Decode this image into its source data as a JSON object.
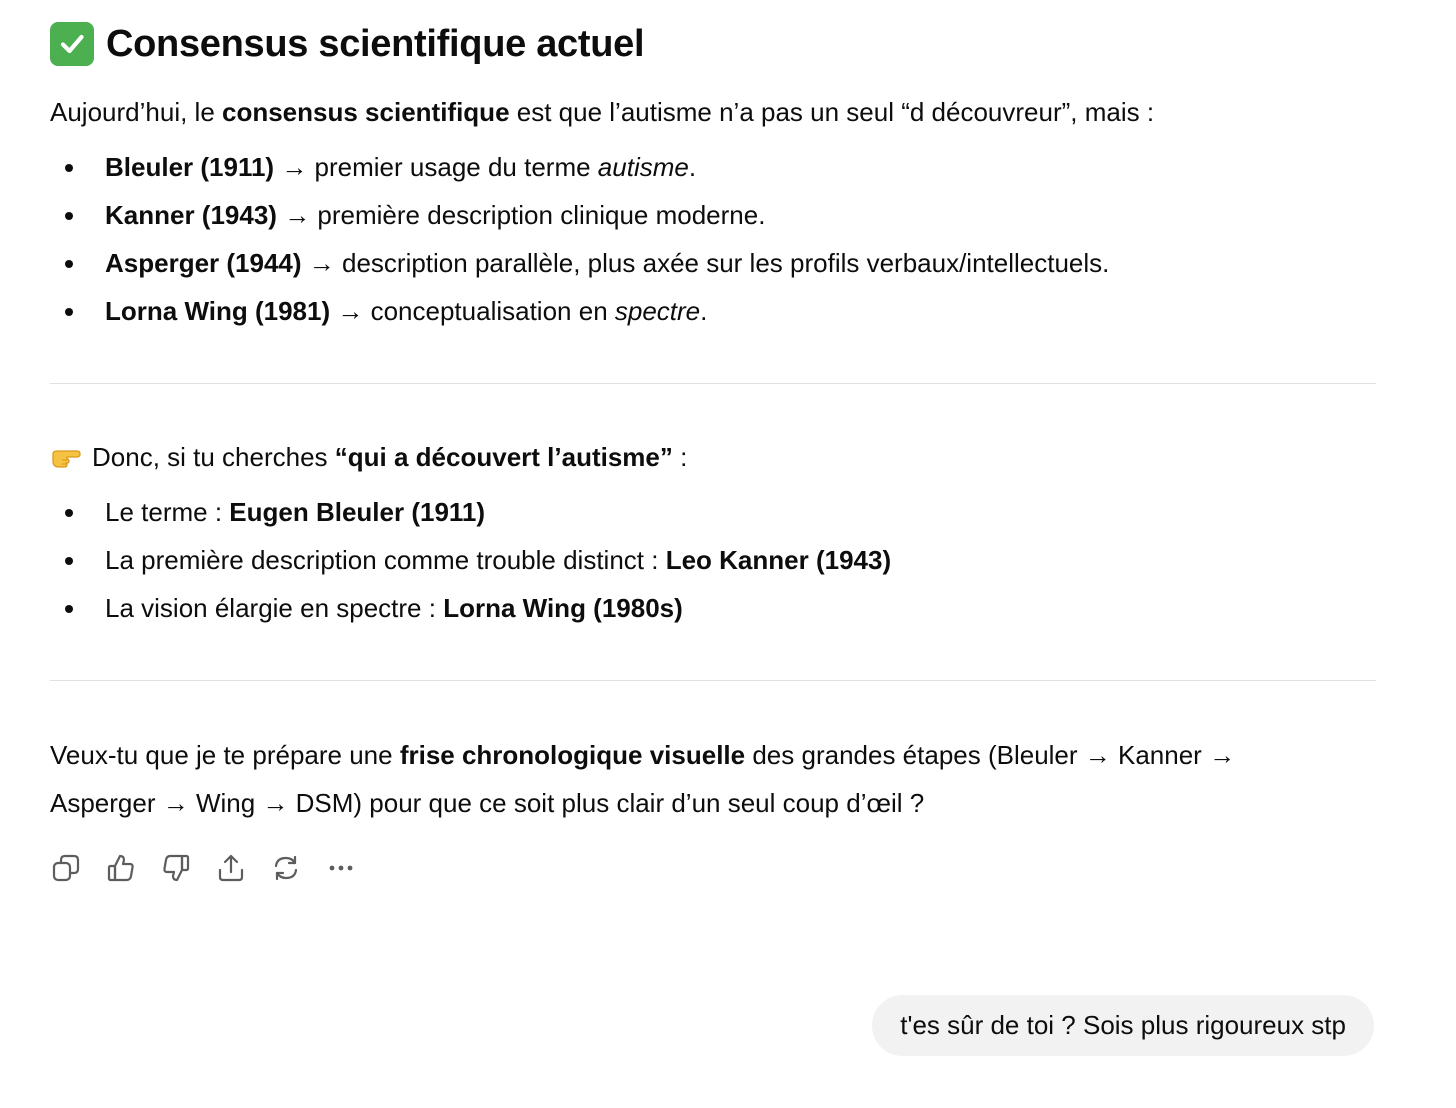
{
  "heading": {
    "icon": "check-mark-button-icon",
    "title": "Consensus scientifique actuel"
  },
  "intro": {
    "prefix": "Aujourd’hui, le ",
    "bold": "consensus scientifique",
    "suffix": " est que l’autisme n’a pas un seul “d découvreur”, mais :"
  },
  "consensus_list": [
    {
      "bold": "Bleuler (1911)",
      "text": " → premier usage du terme ",
      "italic": "autisme",
      "end": "."
    },
    {
      "bold": "Kanner (1943)",
      "text": " → première description clinique moderne."
    },
    {
      "bold": "Asperger (1944)",
      "text": " → description parallèle, plus axée sur les profils verbaux/intellectuels."
    },
    {
      "bold": "Lorna Wing (1981)",
      "text": " → conceptualisation en ",
      "italic": "spectre",
      "end": "."
    }
  ],
  "summary": {
    "icon": "backhand-pointing-right-icon",
    "prefix": "Donc, si tu cherches ",
    "bold": "“qui a découvert l’autisme”",
    "suffix": " :"
  },
  "summary_list": [
    {
      "text": "Le terme : ",
      "bold": "Eugen Bleuler (1911)"
    },
    {
      "text": "La première description comme trouble distinct : ",
      "bold": "Leo Kanner (1943)"
    },
    {
      "text": "La vision élargie en spectre : ",
      "bold": "Lorna Wing (1980s)"
    }
  ],
  "question": {
    "line1_prefix": "Veux-tu que je te prépare une ",
    "line1_bold": "frise chronologique visuelle",
    "line1_suffix": " des grandes étapes (Bleuler → Kanner →",
    "line2": "Asperger → Wing → DSM) pour que ce soit plus clair d’un seul coup d’œil ?"
  },
  "actions": [
    {
      "icon": "copy-icon"
    },
    {
      "icon": "thumbs-up-icon"
    },
    {
      "icon": "thumbs-down-icon"
    },
    {
      "icon": "share-icon"
    },
    {
      "icon": "regenerate-icon"
    },
    {
      "icon": "more-icon"
    }
  ],
  "user_message": "t'es sûr de toi ? Sois plus rigoureux stp"
}
